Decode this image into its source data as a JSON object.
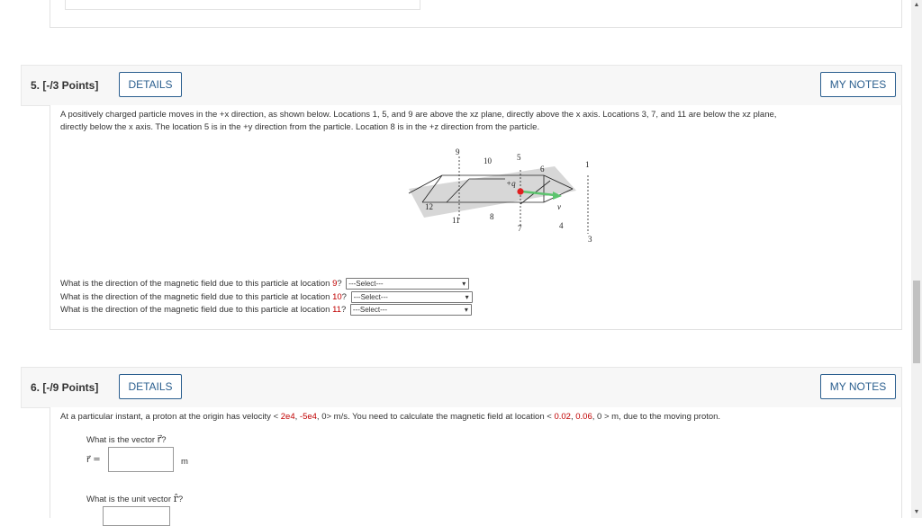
{
  "q5": {
    "number_label": "5.  [-/3 Points]",
    "details_label": "DETAILS",
    "notes_label": "MY NOTES",
    "text_line1": "A positively charged particle moves in the +x direction, as shown below. Locations 1, 5, and 9 are above the xz plane, directly above the x axis. Locations 3, 7, and 11 are below the xz plane,",
    "text_line2": "directly below the x axis. The location 5 is in the +y direction from the particle. Location 8 is in the +z direction from the particle.",
    "figure": {
      "labels": [
        "9",
        "10",
        "5",
        "6",
        "1",
        "2",
        "+q",
        "12",
        "11",
        "8",
        "7",
        "4",
        "3",
        "v"
      ],
      "colors": {
        "plane": "#c9c9c9",
        "charge": "#e02020",
        "velocity": "#5cc46e"
      }
    },
    "questions": [
      {
        "prefix": "What is the direction of the magnetic field due to this particle at location ",
        "loc": "9",
        "suffix": "?",
        "selected": "---Select---"
      },
      {
        "prefix": "What is the direction of the magnetic field due to this particle at location ",
        "loc": "10",
        "suffix": "?",
        "selected": "---Select---"
      },
      {
        "prefix": "What is the direction of the magnetic field due to this particle at location ",
        "loc": "11",
        "suffix": "?",
        "selected": "---Select---"
      }
    ]
  },
  "q6": {
    "number_label": "6.  [-/9 Points]",
    "details_label": "DETAILS",
    "notes_label": "MY NOTES",
    "text_a": "At a particular instant, a proton at the origin has velocity < ",
    "v1": "2e4",
    "sep1": ", ",
    "v2": "-5e4",
    "text_b": ", 0> m/s. You need to calculate the magnetic field at location < ",
    "l1": "0.02",
    "sep2": ", ",
    "l2": "0.06",
    "text_c": ", 0 > m, due to the moving proton.",
    "vector_question": "What is the vector ",
    "vector_symbol": "r⃗",
    "vector_q_end": "?",
    "r_label": "r⃗ =",
    "unit": "m",
    "unit_vector_question": "What is the unit vector ",
    "unit_symbol": "r̂",
    "unit_q_end": "?"
  }
}
